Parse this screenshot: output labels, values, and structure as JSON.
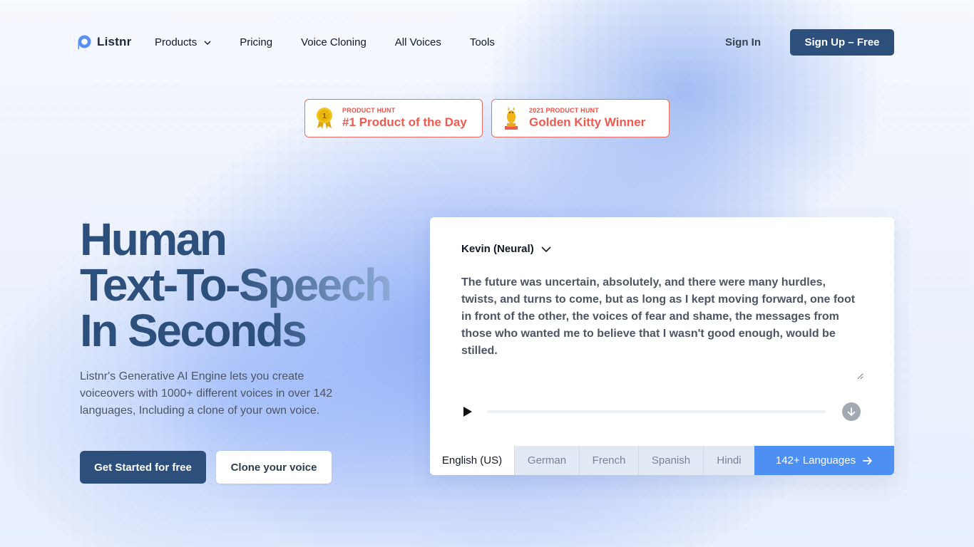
{
  "nav": {
    "logo_text": "Listnr",
    "links": [
      {
        "label": "Products",
        "has_dropdown": true
      },
      {
        "label": "Pricing"
      },
      {
        "label": "Voice Cloning"
      },
      {
        "label": "All Voices"
      },
      {
        "label": "Tools"
      }
    ],
    "sign_in": "Sign In",
    "sign_up": "Sign Up – Free"
  },
  "badges": [
    {
      "small": "PRODUCT HUNT",
      "big": "#1 Product of the Day",
      "icon": "medal-icon",
      "icon_text": "1"
    },
    {
      "small": "2021 PRODUCT HUNT",
      "big": "Golden Kitty Winner",
      "icon": "trophy-icon"
    }
  ],
  "hero": {
    "title_lines": [
      "Human",
      "Text-To-Speech",
      "In Seconds"
    ],
    "subtitle": "Listnr's Generative AI Engine lets you create voiceovers with 1000+ different voices in over 142 languages, Including a clone of your own voice.",
    "primary_cta": "Get Started for free",
    "secondary_cta": "Clone your voice"
  },
  "player": {
    "voice": "Kevin (Neural)",
    "text": "The future was uncertain, absolutely, and there were many hurdles, twists, and turns to come, but as long as I kept moving forward, one foot in front of the other, the voices of fear and shame, the messages from those who wanted me to believe that I wasn't good enough, would be stilled.",
    "progress": 0,
    "languages": [
      "English (US)",
      "German",
      "French",
      "Spanish",
      "Hindi"
    ],
    "active_language": "English (US)",
    "more_languages": "142+ Languages"
  },
  "colors": {
    "brand_navy": "#2c4f7c",
    "accent_blue": "#4d8ff2",
    "badge_red": "#ef5a4f"
  }
}
